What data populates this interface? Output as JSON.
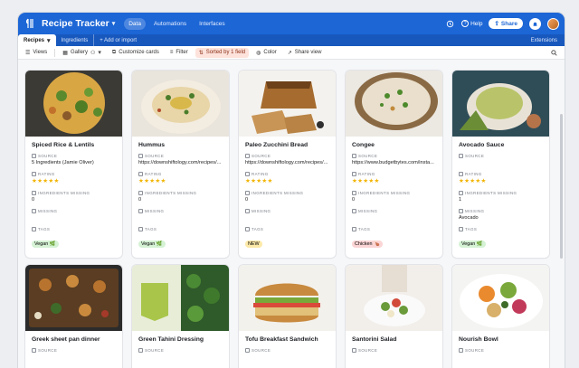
{
  "topbar": {
    "base_name": "Recipe Tracker",
    "tabs": [
      {
        "label": "Data",
        "active": true
      },
      {
        "label": "Automations",
        "active": false
      },
      {
        "label": "Interfaces",
        "active": false
      }
    ],
    "help_label": "Help",
    "share_label": "Share"
  },
  "tablebar": {
    "tabs": [
      "Recipes",
      "Ingredients",
      "+ Add or import"
    ],
    "extensions_label": "Extensions"
  },
  "viewbar": {
    "views_label": "Views",
    "gallery_label": "Gallery",
    "customize_label": "Customize cards",
    "filter_label": "Filter",
    "sort_label": "Sorted by 1 field",
    "color_label": "Color",
    "share_view_label": "Share view"
  },
  "field_labels": {
    "source": "SOURCE",
    "rating": "RATING",
    "missing_count": "INGREDIENTS MISSING",
    "missing": "MISSING",
    "tags": "TAGS"
  },
  "cards": [
    {
      "title": "Spiced Rice & Lentils",
      "source": "5 Ingredients (Jamie Oliver)",
      "rating": "★★★★★",
      "missing_count": "0",
      "missing": "",
      "tag": "Vegan 🌿",
      "tag_color": "#d5f2d5"
    },
    {
      "title": "Hummus",
      "source": "https://downshiftology.com/recipes/...",
      "rating": "★★★★★",
      "missing_count": "0",
      "missing": "",
      "tag": "Vegan 🌿",
      "tag_color": "#d5f2d5"
    },
    {
      "title": "Paleo Zucchini Bread",
      "source": "https://downshiftology.com/recipes/...",
      "rating": "★★★★★",
      "missing_count": "0",
      "missing": "",
      "tag": "NEW",
      "tag_color": "#fde9a8"
    },
    {
      "title": "Congee",
      "source": "https://www.budgetbytes.com/insta...",
      "rating": "★★★★★",
      "missing_count": "0",
      "missing": "",
      "tag": "Chicken 🍗",
      "tag_color": "#fbd5d5"
    },
    {
      "title": "Avocado Sauce",
      "source": "",
      "rating": "★★★★★",
      "missing_count": "1",
      "missing": "Avocado",
      "tag": "Vegan 🌿",
      "tag_color": "#d5f2d5"
    },
    {
      "title": "Greek sheet pan dinner",
      "source": "",
      "rating": "",
      "missing_count": "",
      "missing": "",
      "tag": "",
      "tag_color": ""
    },
    {
      "title": "Green Tahini Dressing",
      "source": "",
      "rating": "",
      "missing_count": "",
      "missing": "",
      "tag": "",
      "tag_color": ""
    },
    {
      "title": "Tofu Breakfast Sandwich",
      "source": "",
      "rating": "",
      "missing_count": "",
      "missing": "",
      "tag": "",
      "tag_color": ""
    },
    {
      "title": "Santorini Salad",
      "source": "",
      "rating": "",
      "missing_count": "",
      "missing": "",
      "tag": "",
      "tag_color": ""
    },
    {
      "title": "Nourish Bowl",
      "source": "",
      "rating": "",
      "missing_count": "",
      "missing": "",
      "tag": "",
      "tag_color": ""
    }
  ]
}
